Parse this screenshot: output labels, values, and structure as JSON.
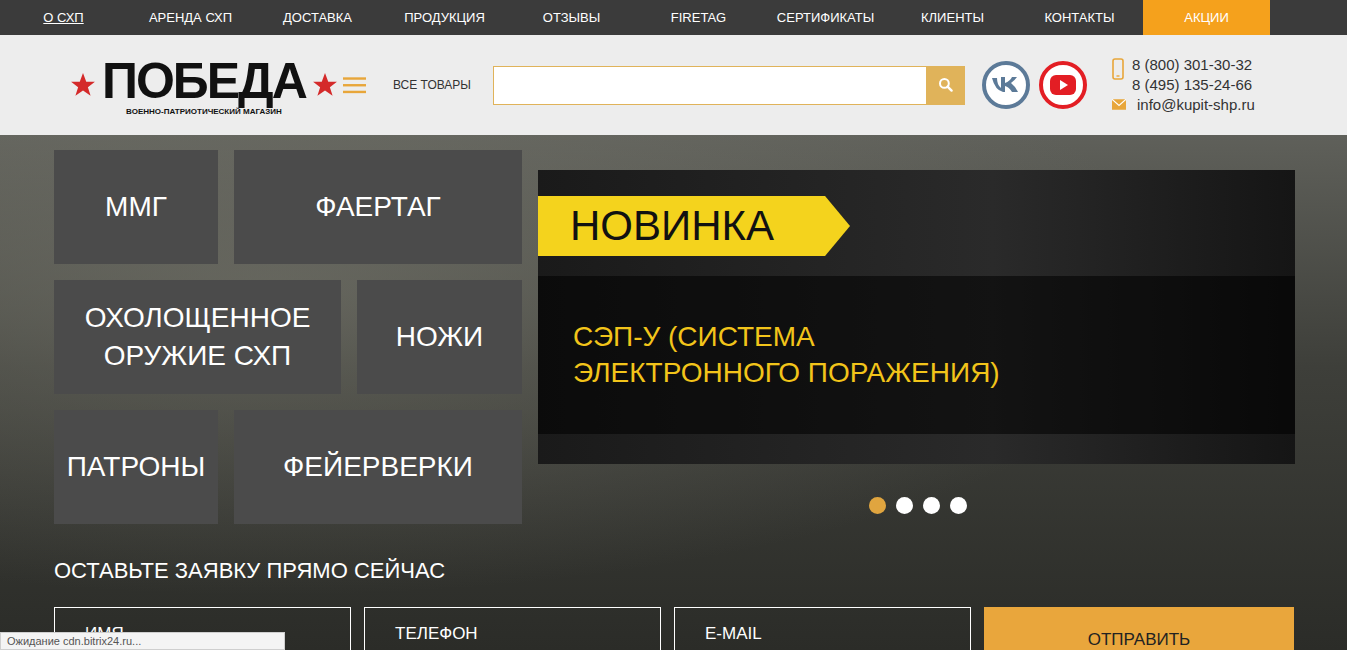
{
  "top_nav": {
    "items": [
      {
        "label": "О СХП",
        "selected": true,
        "highlighted": false
      },
      {
        "label": "АРЕНДА СХП",
        "selected": false,
        "highlighted": false
      },
      {
        "label": "ДОСТАВКА",
        "selected": false,
        "highlighted": false
      },
      {
        "label": "ПРОДУКЦИЯ",
        "selected": false,
        "highlighted": false
      },
      {
        "label": "ОТЗЫВЫ",
        "selected": false,
        "highlighted": false
      },
      {
        "label": "FIRETAG",
        "selected": false,
        "highlighted": false
      },
      {
        "label": "СЕРТИФИКАТЫ",
        "selected": false,
        "highlighted": false
      },
      {
        "label": "КЛИЕНТЫ",
        "selected": false,
        "highlighted": false
      },
      {
        "label": "КОНТАКТЫ",
        "selected": false,
        "highlighted": false
      },
      {
        "label": "АКЦИИ",
        "selected": false,
        "highlighted": true
      }
    ]
  },
  "header": {
    "logo": {
      "title": "ПОБЕДА",
      "subtitle": "ВОЕННО-ПАТРИОТИЧЕСКИЙ МАГАЗИН"
    },
    "menu_label": "ВСЕ ТОВАРЫ",
    "contacts": {
      "phones": [
        "8 (800) 301-30-32",
        "8 (495) 135-24-66"
      ],
      "email": "info@kupit-shp.ru"
    }
  },
  "categories": {
    "rows": [
      {
        "tiles": [
          "ММГ",
          "ФАЕРТАГ"
        ]
      },
      {
        "tiles": [
          "ОХОЛОЩЕННОЕ ОРУЖИЕ СХП",
          "НОЖИ"
        ]
      },
      {
        "tiles": [
          "ПАТРОНЫ",
          "ФЕЙЕРВЕРКИ"
        ]
      }
    ]
  },
  "banner": {
    "badge": "НОВИНКА",
    "title": "СЭП-У (СИСТЕМА ЭЛЕКТРОННОГО ПОРАЖЕНИЯ)",
    "slides": [
      {
        "selected": true
      },
      {
        "selected": false
      },
      {
        "selected": false
      },
      {
        "selected": false
      }
    ]
  },
  "request_form": {
    "title": "ОСТАВЬТЕ ЗАЯВКУ ПРЯМО СЕЙЧАС",
    "fields": [
      {
        "placeholder": "ИМЯ"
      },
      {
        "placeholder": "ТЕЛЕФОН"
      },
      {
        "placeholder": "E-MAIL"
      }
    ],
    "submit": "ОТПРАВИТЬ"
  },
  "status_bar": {
    "text": "Ожидание cdn.bitrix24.ru..."
  }
}
